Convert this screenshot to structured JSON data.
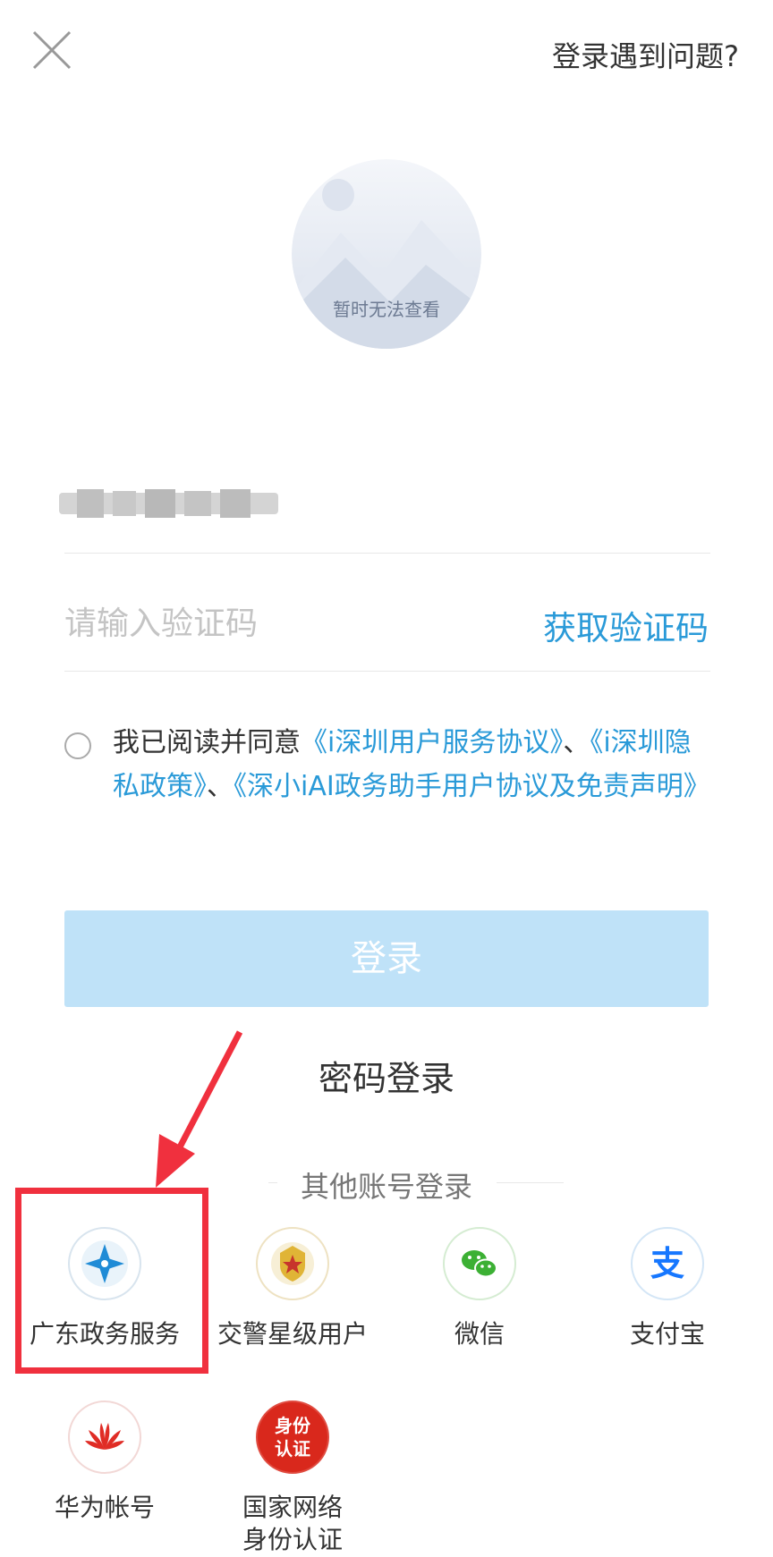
{
  "header": {
    "help_label": "登录遇到问题?"
  },
  "avatar": {
    "placeholder_text": "暂时无法查看"
  },
  "form": {
    "code_placeholder": "请输入验证码",
    "get_code_label": "获取验证码"
  },
  "agreement": {
    "prefix": "我已阅读并同意",
    "link1": "《i深圳用户服务协议》",
    "sep1": "、",
    "link2": "《i深圳隐私政策》",
    "sep2": "、",
    "link3": "《深小iAI政务助手用户协议及免责声明》"
  },
  "login_button": "登录",
  "password_login": "密码登录",
  "other_login": {
    "title": "其他账号登录",
    "providers": [
      {
        "label": "广东政务服务",
        "icon": "guangdong-gov-icon"
      },
      {
        "label": "交警星级用户",
        "icon": "traffic-police-badge-icon"
      },
      {
        "label": "微信",
        "icon": "wechat-icon"
      },
      {
        "label": "支付宝",
        "icon": "alipay-icon"
      },
      {
        "label": "华为帐号",
        "icon": "huawei-icon"
      },
      {
        "label": "国家网络\n身份认证",
        "icon": "national-id-auth-icon",
        "icon_text": "身份认证"
      }
    ]
  },
  "colors": {
    "link": "#2a9ad8",
    "login_button_bg": "#bfe2f8",
    "highlight": "#f0303e"
  }
}
